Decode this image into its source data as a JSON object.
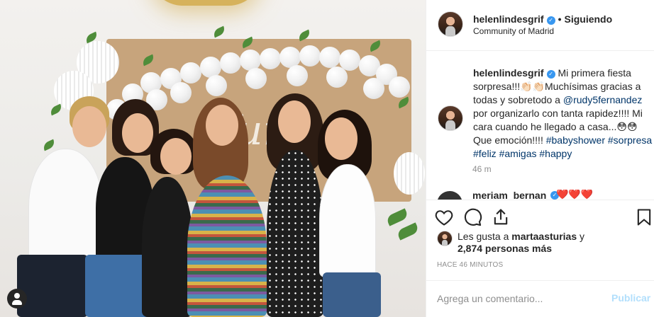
{
  "post": {
    "photo_overlay_text": "Yuri",
    "username": "helenlindesgrif",
    "separator": "•",
    "follow_status": "Siguiendo",
    "location": "Community of Madrid",
    "caption": {
      "username": "helenlindesgrif",
      "text_1": " Mi primera fiesta sorpresa!!!👏🏻👏🏻Muchísimas gracias a todas y sobretodo a ",
      "mention": "@rudy5fernandez",
      "text_2": " por organizarlo con tanta rapidez!!!! Mi cara cuando he llegado a casa...😳😳 Que emoción!!!! ",
      "hashtags": [
        "#babyshower",
        "#sorpresa",
        "#feliz",
        "#amigas",
        "#happy"
      ]
    },
    "caption_time": "46 m",
    "next_comment_user": "meriam_bernan",
    "next_comment_text": "❤️❤️❤️",
    "likes": {
      "prefix": "Les gusta a ",
      "user": "martaasturias",
      "suffix": " y",
      "count_line": "2,874 personas más"
    },
    "timestamp": "HACE 46 MINUTOS",
    "comment_placeholder": "Agrega un comentario...",
    "publish_label": "Publicar"
  },
  "colors": {
    "link": "#003569",
    "verified": "#3897f0",
    "publish_disabled": "#b2dffc",
    "meta_gray": "#8e8e8e"
  },
  "icons": [
    "heart-icon",
    "comment-icon",
    "share-icon",
    "bookmark-icon",
    "verified-icon",
    "user-tag-icon"
  ]
}
